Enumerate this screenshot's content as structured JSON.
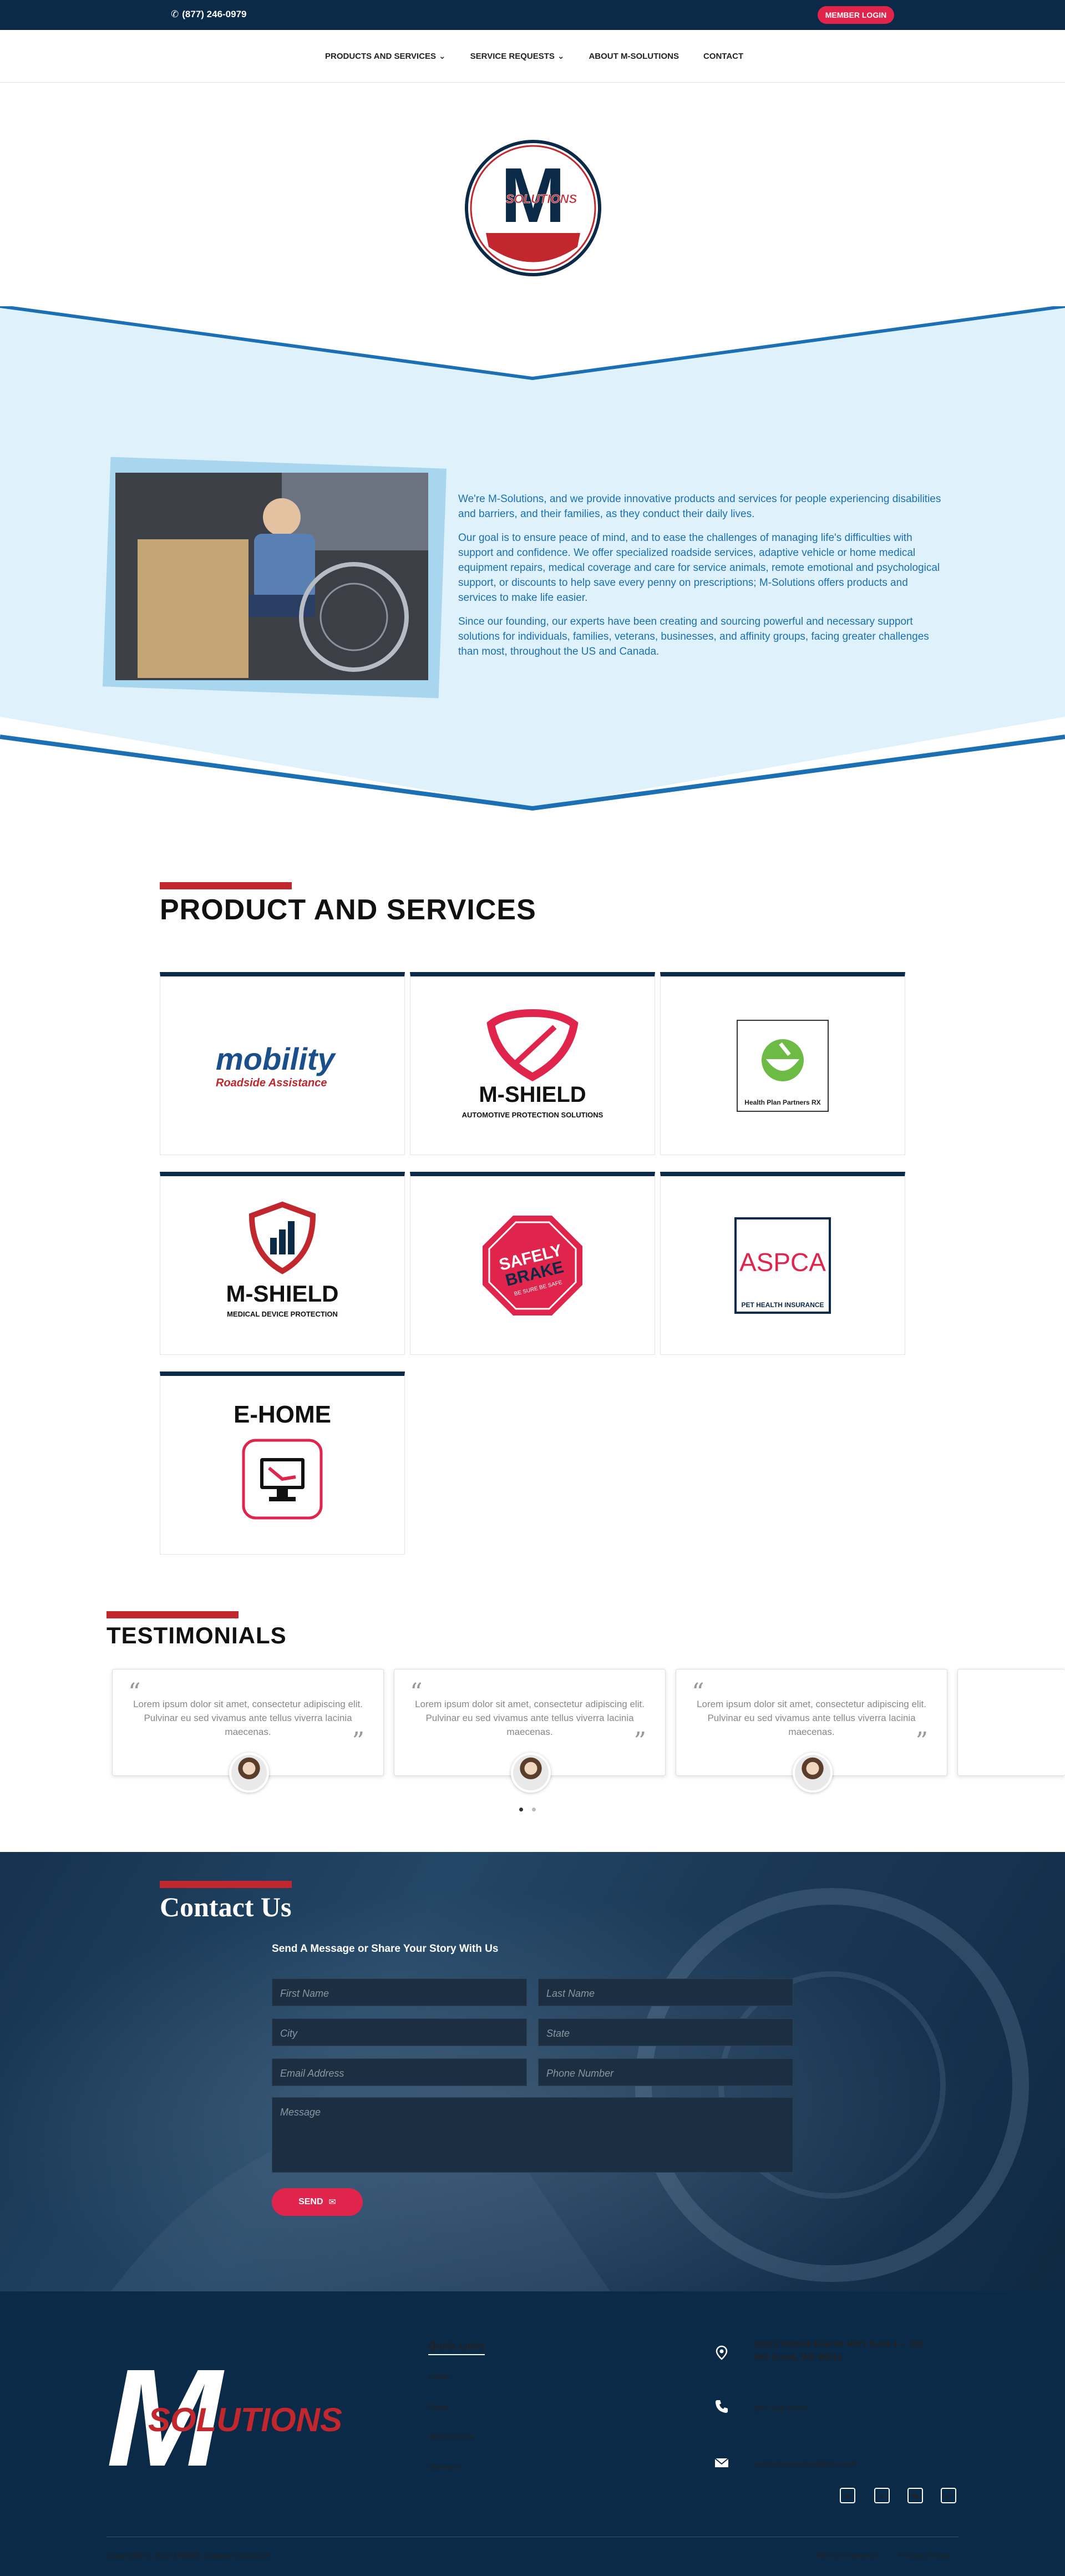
{
  "topbar": {
    "phone": "(877) 246-0979",
    "member_login": "MEMBER LOGIN"
  },
  "nav": {
    "items": [
      "PRODUCTS AND SERVICES",
      "SERVICE REQUESTS",
      "ABOUT M-SOLUTIONS",
      "CONTACT"
    ]
  },
  "logo": {
    "letter": "M",
    "word": "SOLUTIONS"
  },
  "about": {
    "paragraphs": [
      "We're M-Solutions, and we provide innovative products and services for people experiencing disabilities and barriers, and their families, as they conduct their daily lives.",
      "Our goal is to ensure peace of mind, and to ease the challenges of managing life's difficulties with support and confidence. We offer specialized roadside services, adaptive vehicle or home medical equipment repairs, medical coverage and care for service animals, remote emotional and psychological support, or discounts to help save every penny on prescriptions; M-Solutions offers products and services to make life easier.",
      "Since our founding, our experts have been creating and sourcing powerful and necessary support solutions for individuals, families, veterans, businesses, and affinity groups, facing greater challenges than most, throughout the US and Canada."
    ]
  },
  "products": {
    "title": "PRODUCT AND SERVICES",
    "mobility": {
      "word": "mobility",
      "tag": "Roadside Assistance"
    },
    "mshield_auto": {
      "name": "M-SHIELD",
      "tag": "AUTOMOTIVE PROTECTION SOLUTIONS"
    },
    "hpp": {
      "tag": "Health Plan Partners RX"
    },
    "mshield_med": {
      "name": "M-SHIELD",
      "tag": "MEDICAL DEVICE PROTECTION"
    },
    "safely": {
      "line1": "SAFELY",
      "line2": "BRAKE",
      "line3": "BE SURE BE SAFE"
    },
    "aspca": {
      "name": "ASPCA",
      "tag": "PET HEALTH INSURANCE"
    },
    "ehome": {
      "name": "E-HOME"
    }
  },
  "testimonials": {
    "title": "TESTIMONIALS",
    "items": [
      {
        "text": "Lorem ipsum dolor sit amet, consectetur adipiscing elit. Pulvinar eu sed vivamus ante tellus viverra lacinia maecenas."
      },
      {
        "text": "Lorem ipsum dolor sit amet, consectetur adipiscing elit. Pulvinar eu sed vivamus ante tellus viverra lacinia maecenas."
      },
      {
        "text": "Lorem ipsum dolor sit amet, consectetur adipiscing elit. Pulvinar eu sed vivamus ante tellus viverra lacinia maecenas."
      }
    ]
  },
  "contact": {
    "title": "Contact Us",
    "subtitle": "Send A Message or Share Your Story With Us",
    "first_name": "First Name",
    "last_name": "Last Name",
    "city": "City",
    "state": "State",
    "email": "Email Address",
    "phone": "Phone Number",
    "message": "Message",
    "send": "SEND"
  },
  "footer": {
    "logo_letter": "M",
    "logo_word": "SOLUTIONS",
    "quick_links_title": "Quick Links",
    "quick_links": [
      "Home",
      "News",
      "Testimonials",
      "Services"
    ],
    "address_line1": "16212 Bothell Everett HWY Suite F – 132",
    "address_line2": "Mill Creek, WA 98012",
    "phone": "877-246-0979",
    "email": "customerservice@mss.com",
    "copyright": "Copyright © 2022 Mobility Support Solutions",
    "terms": "Terms of Service",
    "privacy": "Privacy Policy"
  },
  "colors": {
    "navy": "#0b2a47",
    "red": "#c1272d",
    "pink": "#e0244c",
    "blue_text": "#1a6fb5",
    "band": "#dff1fb"
  }
}
